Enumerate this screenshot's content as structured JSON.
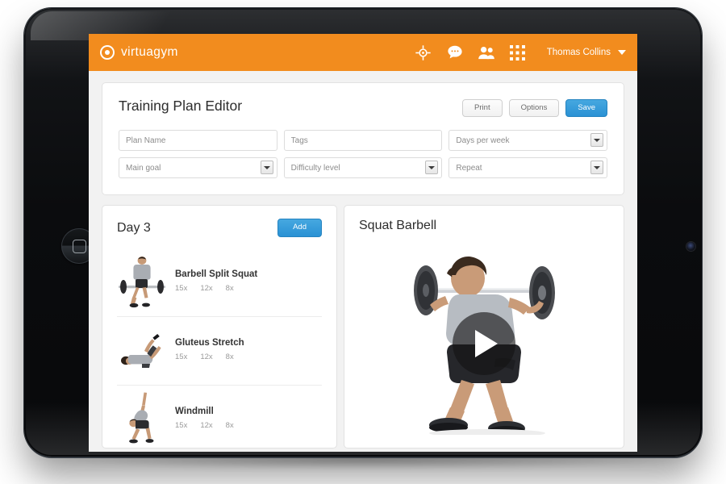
{
  "topbar": {
    "brand": "virtuagym",
    "brand_color": "#f28c1e",
    "icons": [
      "target-icon",
      "chat-icon",
      "friends-icon",
      "apps-grid-icon"
    ],
    "user_name": "Thomas Collins"
  },
  "editor": {
    "title": "Training Plan Editor",
    "buttons": {
      "print": "Print",
      "options": "Options",
      "save": "Save"
    },
    "save_color": "#2a91d4",
    "fields_row1": [
      {
        "name": "plan-name",
        "placeholder": "Plan Name",
        "value": "",
        "type": "text"
      },
      {
        "name": "tags",
        "placeholder": "Tags",
        "value": "",
        "type": "text"
      },
      {
        "name": "days-per-week",
        "placeholder": "Days per week",
        "value": "Days per week",
        "type": "select"
      }
    ],
    "fields_row2": [
      {
        "name": "main-goal",
        "placeholder": "Main goal",
        "value": "Main goal",
        "type": "select"
      },
      {
        "name": "difficulty-level",
        "placeholder": "Difficulty level",
        "value": "Difficulty level",
        "type": "select"
      },
      {
        "name": "repeat",
        "placeholder": "Repeat",
        "value": "Repeat",
        "type": "select"
      }
    ]
  },
  "day_panel": {
    "title": "Day 3",
    "add_label": "Add",
    "exercises": [
      {
        "name": "Barbell Split Squat",
        "reps": [
          "15x",
          "12x",
          "8x"
        ],
        "thumb": "barbell-split-squat-thumb"
      },
      {
        "name": "Gluteus Stretch",
        "reps": [
          "15x",
          "12x",
          "8x"
        ],
        "thumb": "gluteus-stretch-thumb"
      },
      {
        "name": "Windmill",
        "reps": [
          "15x",
          "12x",
          "8x"
        ],
        "thumb": "windmill-thumb"
      }
    ]
  },
  "video_panel": {
    "title": "Squat Barbell",
    "media": "barbell-squat-animation",
    "play_icon": "play-icon"
  }
}
